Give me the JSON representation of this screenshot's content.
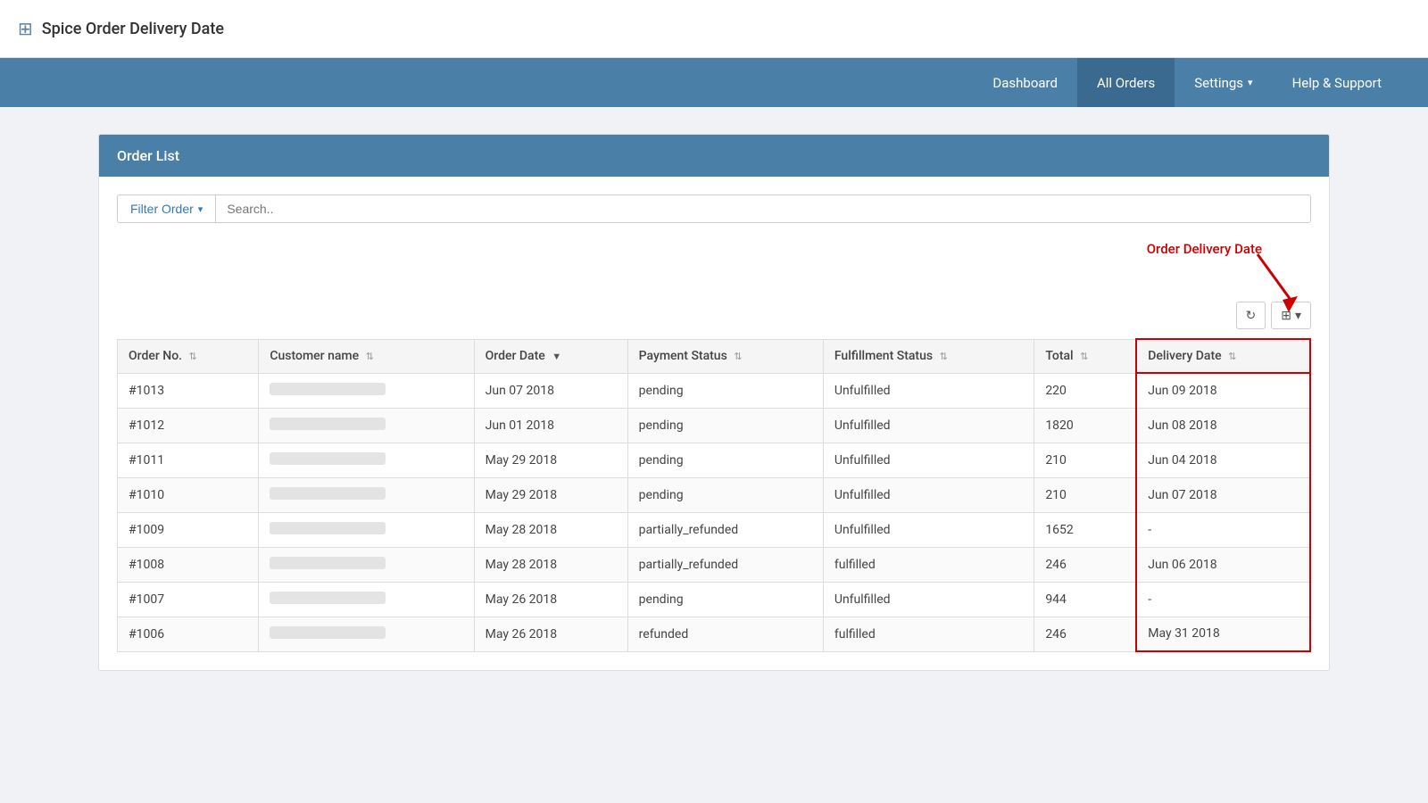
{
  "brand": {
    "icon": "⊞",
    "title": "Spice Order Delivery Date"
  },
  "nav": {
    "items": [
      {
        "id": "dashboard",
        "label": "Dashboard",
        "active": false
      },
      {
        "id": "all-orders",
        "label": "All Orders",
        "active": true
      },
      {
        "id": "settings",
        "label": "Settings",
        "active": false,
        "hasDropdown": true
      },
      {
        "id": "help-support",
        "label": "Help & Support",
        "active": false
      }
    ]
  },
  "card": {
    "header": "Order List"
  },
  "filter": {
    "button_label": "Filter Order",
    "search_placeholder": "Search.."
  },
  "annotation": {
    "label": "Order Delivery Date"
  },
  "toolbar": {
    "refresh_icon": "↻",
    "columns_icon": "⊞"
  },
  "table": {
    "columns": [
      {
        "id": "order-no",
        "label": "Order No.",
        "sortable": true,
        "active": false
      },
      {
        "id": "customer-name",
        "label": "Customer name",
        "sortable": true,
        "active": false
      },
      {
        "id": "order-date",
        "label": "Order Date",
        "sortable": true,
        "active": true
      },
      {
        "id": "payment-status",
        "label": "Payment Status",
        "sortable": true,
        "active": false
      },
      {
        "id": "fulfillment-status",
        "label": "Fulfillment Status",
        "sortable": true,
        "active": false
      },
      {
        "id": "total",
        "label": "Total",
        "sortable": true,
        "active": false
      },
      {
        "id": "delivery-date",
        "label": "Delivery Date",
        "sortable": true,
        "active": false
      }
    ],
    "rows": [
      {
        "order_no": "#1013",
        "order_date": "Jun 07 2018",
        "payment_status": "pending",
        "fulfillment_status": "Unfulfilled",
        "total": "220",
        "delivery_date": "Jun 09 2018"
      },
      {
        "order_no": "#1012",
        "order_date": "Jun 01 2018",
        "payment_status": "pending",
        "fulfillment_status": "Unfulfilled",
        "total": "1820",
        "delivery_date": "Jun 08 2018"
      },
      {
        "order_no": "#1011",
        "order_date": "May 29 2018",
        "payment_status": "pending",
        "fulfillment_status": "Unfulfilled",
        "total": "210",
        "delivery_date": "Jun 04 2018"
      },
      {
        "order_no": "#1010",
        "order_date": "May 29 2018",
        "payment_status": "pending",
        "fulfillment_status": "Unfulfilled",
        "total": "210",
        "delivery_date": "Jun 07 2018"
      },
      {
        "order_no": "#1009",
        "order_date": "May 28 2018",
        "payment_status": "partially_refunded",
        "fulfillment_status": "Unfulfilled",
        "total": "1652",
        "delivery_date": "-"
      },
      {
        "order_no": "#1008",
        "order_date": "May 28 2018",
        "payment_status": "partially_refunded",
        "fulfillment_status": "fulfilled",
        "total": "246",
        "delivery_date": "Jun 06 2018"
      },
      {
        "order_no": "#1007",
        "order_date": "May 26 2018",
        "payment_status": "pending",
        "fulfillment_status": "Unfulfilled",
        "total": "944",
        "delivery_date": "-"
      },
      {
        "order_no": "#1006",
        "order_date": "May 26 2018",
        "payment_status": "refunded",
        "fulfillment_status": "fulfilled",
        "total": "246",
        "delivery_date": "May 31 2018"
      }
    ]
  }
}
